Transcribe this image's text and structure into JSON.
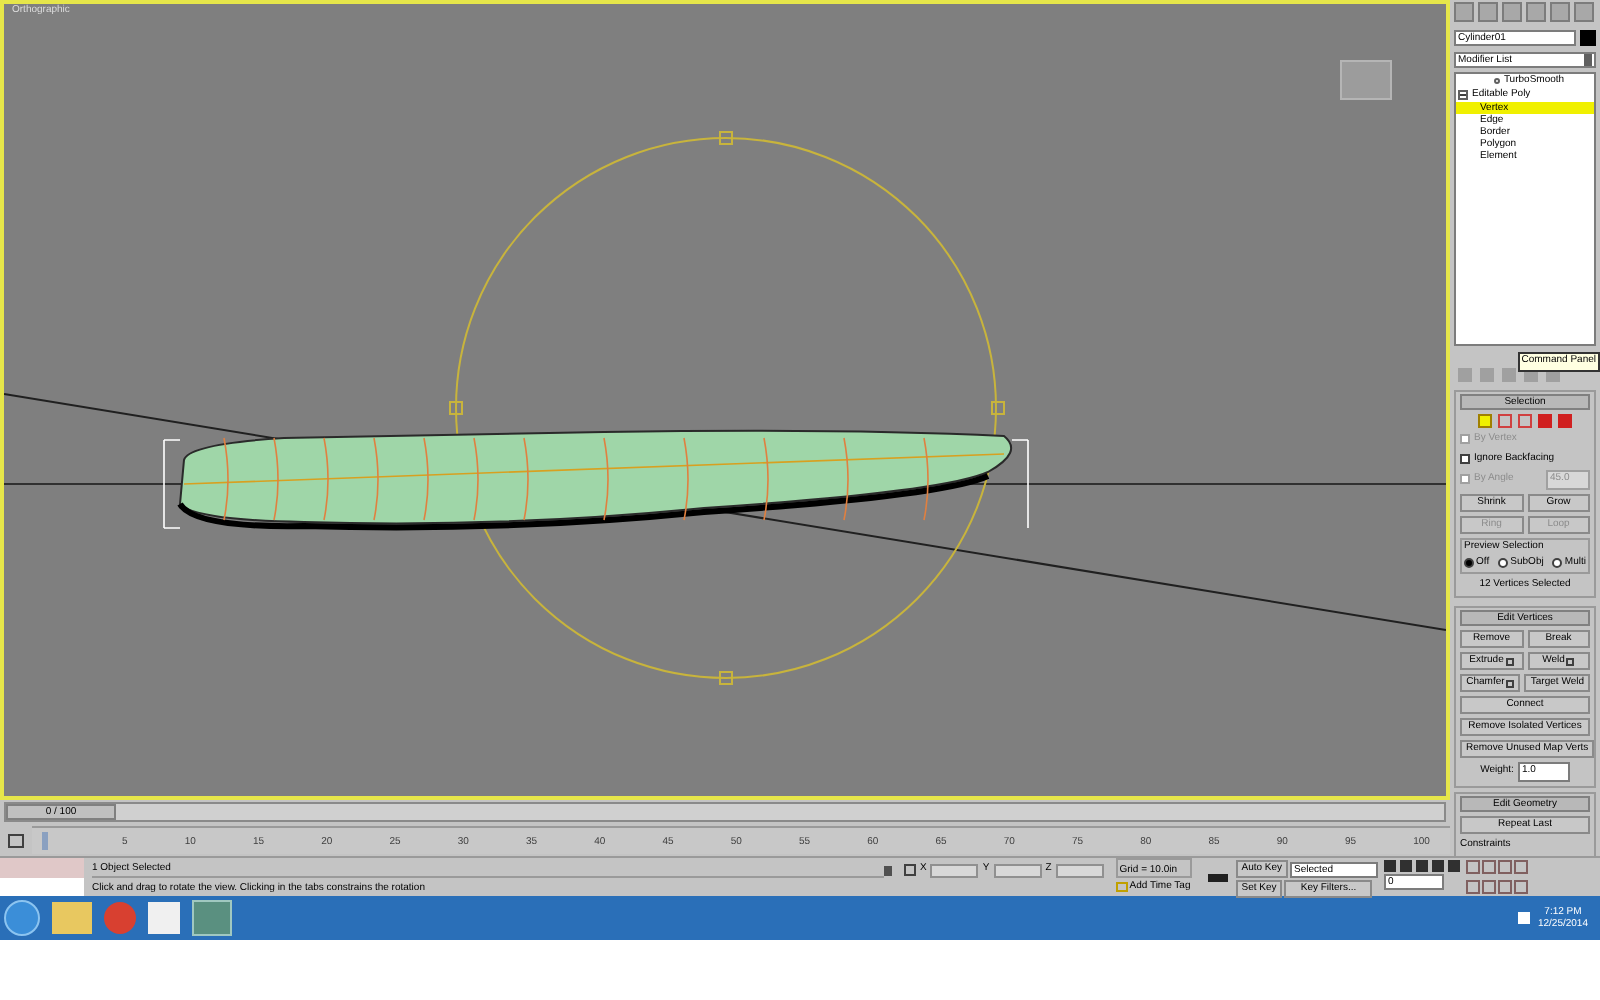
{
  "viewport": {
    "label": "Orthographic"
  },
  "command_panel": {
    "object_name": "Cylinder01",
    "modifier_list": "Modifier List",
    "stack": [
      {
        "label": "TurboSmooth",
        "kind": "modifier"
      },
      {
        "label": "Editable Poly",
        "kind": "base",
        "expanded": true,
        "children": [
          {
            "label": "Vertex",
            "selected": true
          },
          {
            "label": "Edge",
            "selected": false
          },
          {
            "label": "Border",
            "selected": false
          },
          {
            "label": "Polygon",
            "selected": false
          },
          {
            "label": "Element",
            "selected": false
          }
        ]
      }
    ],
    "tooltip": "Command Panel",
    "selection": {
      "title": "Selection",
      "modes": [
        {
          "selected": true
        },
        {
          "selected": false
        },
        {
          "selected": false
        },
        {
          "selected": false
        },
        {
          "selected": false
        }
      ],
      "checkboxes": [
        {
          "label": "By Vertex",
          "checked": false,
          "disabled": true
        },
        {
          "label": "Ignore Backfacing",
          "checked": false,
          "disabled": false
        },
        {
          "label": "By Angle",
          "checked": false,
          "disabled": true,
          "value": "45.0"
        }
      ],
      "buttons": [
        "Shrink",
        "Grow"
      ],
      "spinners": [
        "Ring",
        "Loop"
      ],
      "preview_title": "Preview Selection",
      "preview_options": [
        {
          "label": "Off",
          "selected": true
        },
        {
          "label": "SubObj",
          "selected": false
        },
        {
          "label": "Multi",
          "selected": false
        }
      ],
      "status": "12 Vertices Selected"
    },
    "edit_vertices": {
      "title": "Edit Vertices",
      "rows": [
        [
          {
            "label": "Remove",
            "settings": false
          },
          {
            "label": "Break",
            "settings": false
          }
        ],
        [
          {
            "label": "Extrude",
            "settings": true
          },
          {
            "label": "Weld",
            "settings": true
          }
        ],
        [
          {
            "label": "Chamfer",
            "settings": true
          },
          {
            "label": "Target Weld",
            "settings": false
          }
        ],
        [
          {
            "label": "Connect",
            "settings": false
          }
        ],
        [
          {
            "label": "Remove Isolated Vertices",
            "settings": false
          }
        ],
        [
          {
            "label": "Remove Unused Map Verts",
            "settings": false
          }
        ]
      ],
      "weight": {
        "label": "Weight:",
        "value": "1.0"
      }
    },
    "edit_geometry": {
      "title": "Edit Geometry",
      "button": "Repeat Last",
      "group": "Constraints"
    }
  },
  "time_slider": {
    "label": "0 / 100",
    "level": 0
  },
  "track_ticks": [
    "5",
    "10",
    "15",
    "20",
    "25",
    "30",
    "35",
    "40",
    "45",
    "50",
    "55",
    "60",
    "65",
    "70",
    "75",
    "80",
    "85",
    "90",
    "95",
    "100"
  ],
  "status_bar": {
    "selection": "1 Object Selected",
    "prompt": "Click and drag to rotate the view.  Clicking in the tabs constrains the rotation",
    "coords": [
      "X",
      "Y",
      "Z"
    ],
    "grid": "Grid = 10.0in",
    "time_tag": "Add Time Tag",
    "auto_key": "Auto Key",
    "key_mode": "Selected",
    "set_key": "Set Key",
    "key_filters": "Key Filters...",
    "frame": "0"
  },
  "taskbar": {
    "time": "7:12 PM",
    "date": "12/25/2014"
  }
}
